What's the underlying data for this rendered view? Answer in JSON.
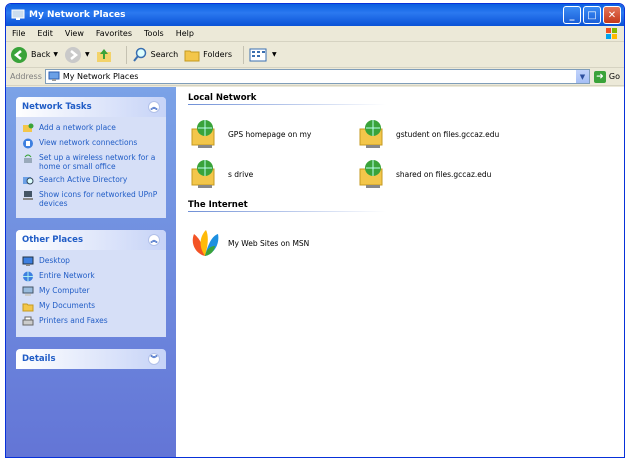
{
  "window": {
    "title": "My Network Places"
  },
  "menu": [
    "File",
    "Edit",
    "View",
    "Favorites",
    "Tools",
    "Help"
  ],
  "toolbar": {
    "back": "Back",
    "search": "Search",
    "folders": "Folders"
  },
  "address": {
    "label": "Address",
    "value": "My Network Places",
    "go": "Go"
  },
  "network_tasks": {
    "title": "Network Tasks",
    "items": [
      {
        "label": "Add a network place",
        "icon": "add-network-place-icon"
      },
      {
        "label": "View network connections",
        "icon": "network-connections-icon"
      },
      {
        "label": "Set up a wireless network for a home or small office",
        "icon": "wireless-icon"
      },
      {
        "label": "Search Active Directory",
        "icon": "search-directory-icon"
      },
      {
        "label": "Show icons for networked UPnP devices",
        "icon": "upnp-icon"
      }
    ]
  },
  "other_places": {
    "title": "Other Places",
    "items": [
      {
        "label": "Desktop",
        "icon": "desktop-icon"
      },
      {
        "label": "Entire Network",
        "icon": "entire-network-icon"
      },
      {
        "label": "My Computer",
        "icon": "computer-icon"
      },
      {
        "label": "My Documents",
        "icon": "documents-icon"
      },
      {
        "label": "Printers and Faxes",
        "icon": "printer-icon"
      }
    ]
  },
  "details": {
    "title": "Details"
  },
  "local_network": {
    "title": "Local Network",
    "items": [
      {
        "label": "GPS homepage on my"
      },
      {
        "label": "gstudent on files.gccaz.edu"
      },
      {
        "label": "s drive"
      },
      {
        "label": "shared on files.gccaz.edu"
      }
    ]
  },
  "internet": {
    "title": "The Internet",
    "items": [
      {
        "label": "My Web Sites on MSN"
      }
    ]
  }
}
